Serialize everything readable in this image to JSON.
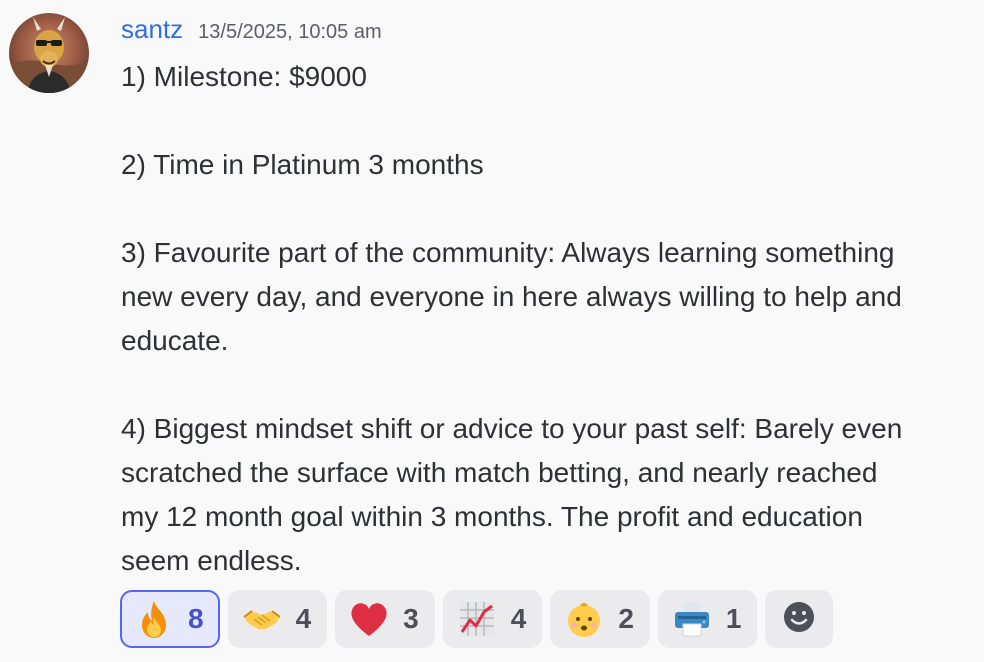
{
  "message": {
    "author": "santz",
    "timestamp": "13/5/2025, 10:05 am",
    "lines": [
      "1) Milestone: $9000",
      "",
      "2) Time in Platinum 3 months",
      "",
      "3) Favourite part of the community: Always learning something",
      "new every day, and everyone in here always willing to help and",
      "educate.",
      "",
      "4) Biggest mindset shift or advice to your past self: Barely even",
      "scratched the surface with match betting, and nearly reached",
      "my 12 month goal within 3 months. The profit and education",
      "seem endless."
    ]
  },
  "reactions": [
    {
      "icon": "fire-emoji-icon",
      "count": "8",
      "selected": true
    },
    {
      "icon": "handshake-emoji-icon",
      "count": "4",
      "selected": false
    },
    {
      "icon": "red-heart-emoji-icon",
      "count": "3",
      "selected": false
    },
    {
      "icon": "chart-increasing-emoji-icon",
      "count": "4",
      "selected": false
    },
    {
      "icon": "baby-emoji-icon",
      "count": "2",
      "selected": false
    },
    {
      "icon": "printer-emoji-icon",
      "count": "1",
      "selected": false
    }
  ],
  "add_reaction": {
    "icon": "add-reaction-icon"
  },
  "colors": {
    "username": "#2f6fe3",
    "selected_border": "#5865f2",
    "selected_background": "#e5e9fb",
    "background": "#f9f9fa"
  }
}
